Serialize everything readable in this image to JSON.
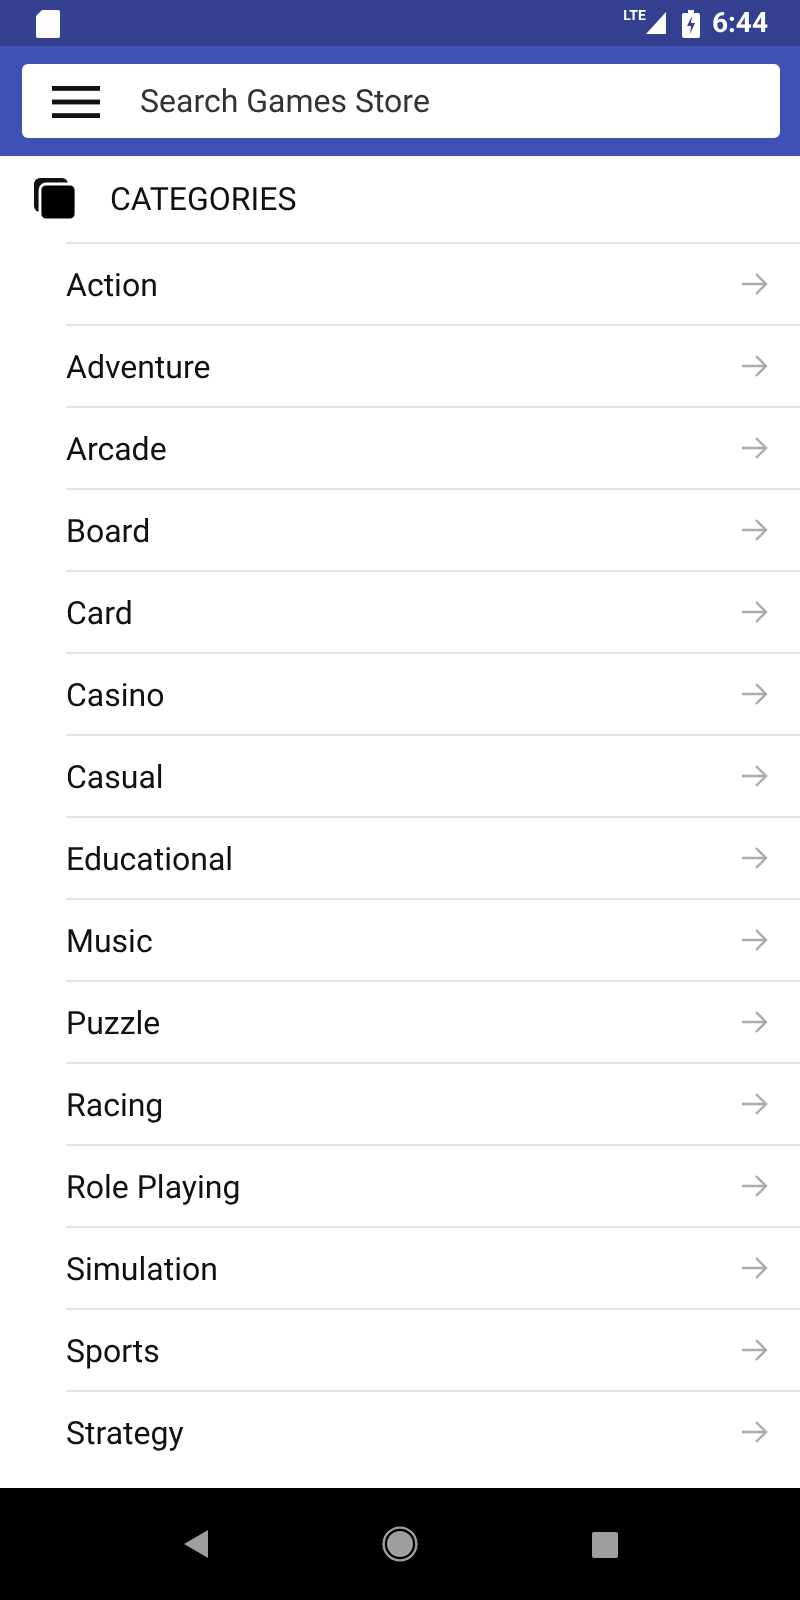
{
  "status_bar": {
    "network": "LTE",
    "time": "6:44"
  },
  "search": {
    "placeholder": "Search Games Store"
  },
  "section": {
    "title": "CATEGORIES"
  },
  "categories": [
    {
      "label": "Action"
    },
    {
      "label": "Adventure"
    },
    {
      "label": "Arcade"
    },
    {
      "label": "Board"
    },
    {
      "label": "Card"
    },
    {
      "label": "Casino"
    },
    {
      "label": "Casual"
    },
    {
      "label": "Educational"
    },
    {
      "label": "Music"
    },
    {
      "label": "Puzzle"
    },
    {
      "label": "Racing"
    },
    {
      "label": "Role Playing"
    },
    {
      "label": "Simulation"
    },
    {
      "label": "Sports"
    },
    {
      "label": "Strategy"
    }
  ]
}
